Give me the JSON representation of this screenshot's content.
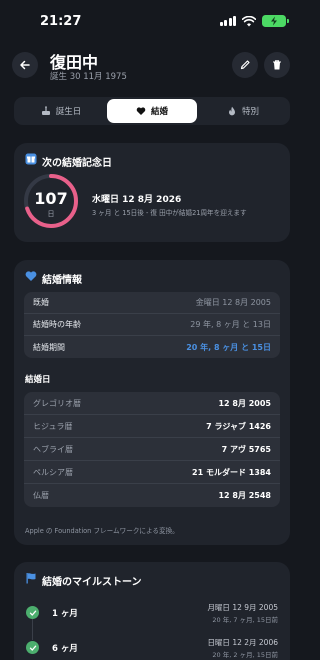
{
  "status_bar": {
    "time": "21:27"
  },
  "header": {
    "name": "復田中",
    "birth": "誕生 30 11月 1975"
  },
  "tabs": [
    {
      "label": "誕生日",
      "icon": "cake-icon"
    },
    {
      "label": "結婚",
      "icon": "heart-icon",
      "selected": true
    },
    {
      "label": "特別",
      "icon": "flame-icon"
    }
  ],
  "next_anniversary": {
    "title": "次の結婚記念日",
    "days": "107",
    "days_unit": "日",
    "progress_fraction": 0.7,
    "date": "水曜日 12 8月 2026",
    "note": "3 ヶ月 と 15日後 - 復 田中が結婚21周年を迎えます"
  },
  "marriage_info": {
    "title": "結婚情報",
    "rows": [
      {
        "label": "既婚",
        "value": "金曜日 12 8月 2005"
      },
      {
        "label": "結婚時の年齢",
        "value": "29 年, 8 ヶ月 と 13日"
      },
      {
        "label": "結婚期間",
        "value": "20 年, 8 ヶ月 と 15日"
      }
    ],
    "calendars_title": "結婚日",
    "calendars": [
      {
        "label": "グレゴリオ暦",
        "value": "12 8月 2005"
      },
      {
        "label": "ヒジュラ暦",
        "value": "7 ラジャブ 1426"
      },
      {
        "label": "ヘブライ暦",
        "value": "7 アヴ 5765"
      },
      {
        "label": "ペルシア暦",
        "value": "21 モルダード 1384"
      },
      {
        "label": "仏暦",
        "value": "12 8月 2548"
      }
    ],
    "footnote": "Apple の Foundation フレームワークによる変換。"
  },
  "milestones": {
    "title": "結婚のマイルストーン",
    "items": [
      {
        "label": "1 ヶ月",
        "date": "月曜日 12 9月 2005",
        "duration": "20 年, 7 ヶ月, 15日前"
      },
      {
        "label": "6 ヶ月",
        "date": "日曜日 12 2月 2006",
        "duration": "20 年, 2 ヶ月, 15日前"
      }
    ]
  },
  "colors": {
    "accent_blue": "#4a90e2",
    "ring_pink": "#e8608a",
    "check_green": "#4cae6e",
    "battery_green": "#4cd964"
  }
}
